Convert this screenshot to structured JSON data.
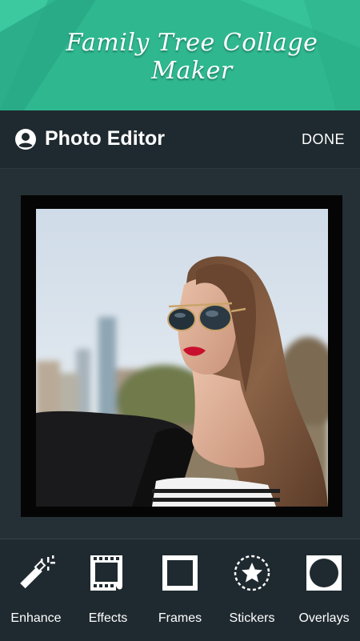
{
  "banner": {
    "title": "Family Tree Collage Maker"
  },
  "appbar": {
    "title": "Photo Editor",
    "done_label": "DONE",
    "icon": "account-circle-icon"
  },
  "colors": {
    "banner_bg": "#2fb890",
    "appbar_bg": "#1f2a30",
    "canvas_bg": "#243036",
    "frame": "#050505"
  },
  "toolbar": {
    "items": [
      {
        "label": "Enhance",
        "icon": "magic-wand-icon"
      },
      {
        "label": "Effects",
        "icon": "film-strip-icon"
      },
      {
        "label": "Frames",
        "icon": "square-frame-icon"
      },
      {
        "label": "Stickers",
        "icon": "star-badge-icon"
      },
      {
        "label": "Overlays",
        "icon": "circle-overlay-icon"
      }
    ]
  }
}
